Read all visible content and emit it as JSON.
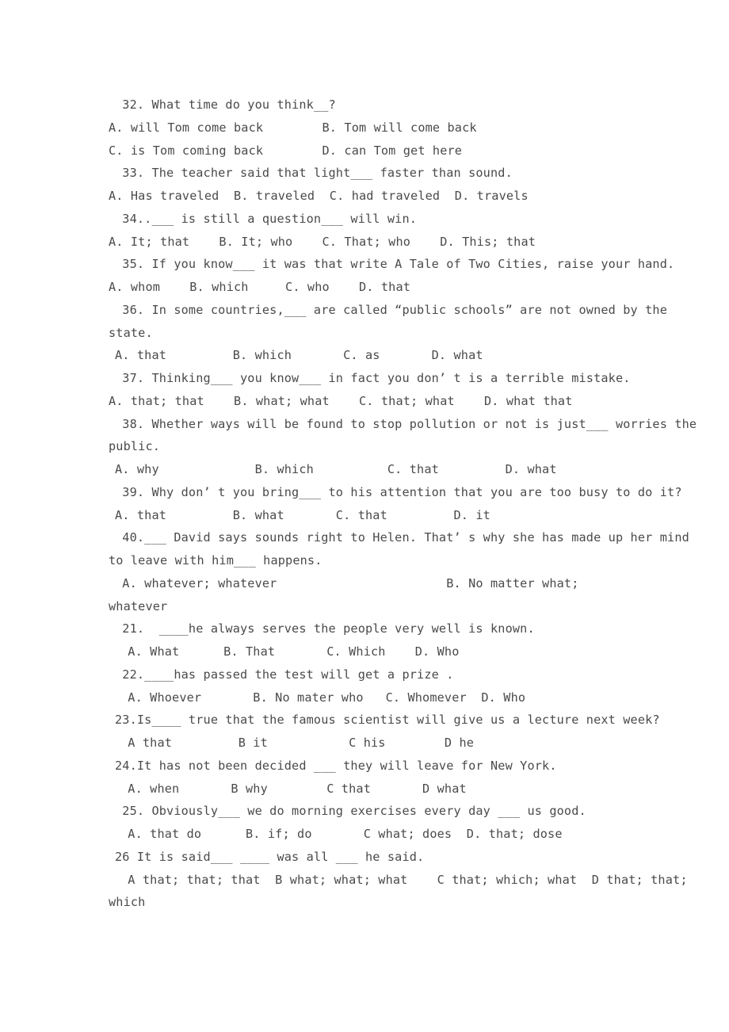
{
  "document": {
    "type": "english-grammar-worksheet",
    "text_color": "#4a4a4a",
    "background_color": "#ffffff",
    "lines": [
      {
        "id": "q32-stem",
        "indent": 1,
        "text": " 32. What time do you think__?"
      },
      {
        "id": "q32-opt-ab",
        "indent": 0,
        "text": "A. will Tom come back        B. Tom will come back"
      },
      {
        "id": "q32-opt-cd",
        "indent": 0,
        "text": "C. is Tom coming back        D. can Tom get here"
      },
      {
        "id": "q33-stem",
        "indent": 1,
        "text": " 33. The teacher said that light___ faster than sound."
      },
      {
        "id": "q33-opts",
        "indent": 0,
        "text": "A. Has traveled  B. traveled  C. had traveled  D. travels"
      },
      {
        "id": "q34-stem",
        "indent": 1,
        "text": " 34..___ is still a question___ will win."
      },
      {
        "id": "q34-opts",
        "indent": 0,
        "text": "A. It; that    B. It; who    C. That; who    D. This; that"
      },
      {
        "id": "q35-stem",
        "indent": 1,
        "text": " 35. If you know___ it was that write A Tale of Two Cities, raise your hand."
      },
      {
        "id": "q35-opts",
        "indent": 0,
        "text": "A. whom    B. which     C. who    D. that"
      },
      {
        "id": "q36-stem",
        "indent": 1,
        "text": " 36. In some countries,___ are called “public schools” are not owned by the"
      },
      {
        "id": "q36-stem-2",
        "indent": 0,
        "text": "state."
      },
      {
        "id": "q36-opts",
        "indent": 1,
        "text": "A. that         B. which       C. as       D. what"
      },
      {
        "id": "q37-stem",
        "indent": 1,
        "text": " 37. Thinking___ you know___ in fact you don’ t is a terrible mistake."
      },
      {
        "id": "q37-opts",
        "indent": 0,
        "text": "A. that; that    B. what; what    C. that; what    D. what that"
      },
      {
        "id": "q38-stem",
        "indent": 1,
        "text": " 38. Whether ways will be found to stop pollution or not is just___ worries the"
      },
      {
        "id": "q38-stem-2",
        "indent": 0,
        "text": "public."
      },
      {
        "id": "q38-opts",
        "indent": 1,
        "text": "A. why             B. which          C. that         D. what"
      },
      {
        "id": "q39-stem",
        "indent": 1,
        "text": " 39. Why don’ t you bring___ to his attention that you are too busy to do it?"
      },
      {
        "id": "q39-opts",
        "indent": 1,
        "text": "A. that         B. what       C. that         D. it"
      },
      {
        "id": "q40-stem",
        "indent": 1,
        "text": " 40.___ David says sounds right to Helen. That’ s why she has made up her mind"
      },
      {
        "id": "q40-stem-2",
        "indent": 0,
        "text": "to leave with him___ happens."
      },
      {
        "id": "q40-opts",
        "indent": 1,
        "text": " A. whatever; whatever                       B. No matter what;"
      },
      {
        "id": "q40-opts-2",
        "indent": 0,
        "text": "whatever"
      },
      {
        "id": "q21-stem",
        "indent": 1,
        "text": " 21.  ____he always serves the people very well is known."
      },
      {
        "id": "q21-opts",
        "indent": 2,
        "text": " A. What      B. That       C. Which    D. Who"
      },
      {
        "id": "q22-stem",
        "indent": 1,
        "text": " 22.____has passed the test will get a prize ."
      },
      {
        "id": "q22-opts",
        "indent": 2,
        "text": " A. Whoever       B. No mater who   C. Whomever  D. Who"
      },
      {
        "id": "q23-stem",
        "indent": 1,
        "text": "23.Is____ true that the famous scientist will give us a lecture next week?"
      },
      {
        "id": "q23-opts",
        "indent": 2,
        "text": " A that         B it           C his        D he"
      },
      {
        "id": "q24-stem",
        "indent": 1,
        "text": "24.It has not been decided ___ they will leave for New York."
      },
      {
        "id": "q24-opts",
        "indent": 2,
        "text": " A. when       B why        C that       D what"
      },
      {
        "id": "q25-stem",
        "indent": 1,
        "text": " 25. Obviously___ we do morning exercises every day ___ us good."
      },
      {
        "id": "q25-opts",
        "indent": 2,
        "text": " A. that do      B. if; do       C what; does  D. that; dose"
      },
      {
        "id": "q26-stem",
        "indent": 1,
        "text": "26 It is said___ ____ was all ___ he said."
      },
      {
        "id": "q26-opts",
        "indent": 2,
        "text": " A that; that; that  B what; what; what    C that; which; what  D that; that;"
      },
      {
        "id": "q26-opts-2",
        "indent": 0,
        "text": "which"
      }
    ]
  }
}
